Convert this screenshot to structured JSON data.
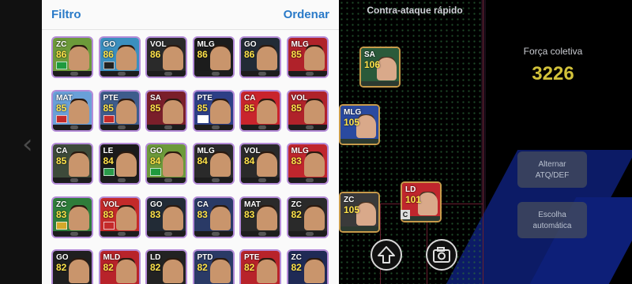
{
  "panel": {
    "filter_label": "Filtro",
    "order_label": "Ordenar",
    "cards": [
      {
        "pos": "ZC",
        "ovr": "86",
        "bg": "#6c9a3a",
        "flag": "#1f9a3e"
      },
      {
        "pos": "GO",
        "ovr": "86",
        "bg": "#3b8fbf",
        "flag": "#222222"
      },
      {
        "pos": "VOL",
        "ovr": "86",
        "bg": "#2a2a2a",
        "flag": ""
      },
      {
        "pos": "MLG",
        "ovr": "86",
        "bg": "#1c1c1c",
        "flag": ""
      },
      {
        "pos": "GO",
        "ovr": "86",
        "bg": "#222b36",
        "flag": ""
      },
      {
        "pos": "MLG",
        "ovr": "85",
        "bg": "#b0222a",
        "flag": ""
      },
      {
        "pos": "MAT",
        "ovr": "85",
        "bg": "#6aa0d8",
        "flag": "#c42a2a"
      },
      {
        "pos": "PTE",
        "ovr": "85",
        "bg": "#3e5c8c",
        "flag": "#c42a2a"
      },
      {
        "pos": "SA",
        "ovr": "85",
        "bg": "#7a1f2a",
        "flag": ""
      },
      {
        "pos": "PTE",
        "ovr": "85",
        "bg": "#2d3f86",
        "flag": "#ffffff"
      },
      {
        "pos": "CA",
        "ovr": "85",
        "bg": "#c9242c",
        "flag": ""
      },
      {
        "pos": "VOL",
        "ovr": "85",
        "bg": "#b0222a",
        "flag": ""
      },
      {
        "pos": "CA",
        "ovr": "85",
        "bg": "#3d4a3a",
        "flag": ""
      },
      {
        "pos": "LE",
        "ovr": "84",
        "bg": "#1b1b1b",
        "flag": "#2a9a4a"
      },
      {
        "pos": "GO",
        "ovr": "84",
        "bg": "#6c9a3a",
        "flag": "#1f9a3e"
      },
      {
        "pos": "MLG",
        "ovr": "84",
        "bg": "#2a2a2a",
        "flag": ""
      },
      {
        "pos": "VOL",
        "ovr": "84",
        "bg": "#2a2a2a",
        "flag": ""
      },
      {
        "pos": "MLG",
        "ovr": "83",
        "bg": "#c0262d",
        "flag": ""
      },
      {
        "pos": "ZC",
        "ovr": "83",
        "bg": "#2e7d3a",
        "flag": "#d4a82a"
      },
      {
        "pos": "VOL",
        "ovr": "83",
        "bg": "#c42a2a",
        "flag": "#c42a2a"
      },
      {
        "pos": "GO",
        "ovr": "83",
        "bg": "#222b36",
        "flag": ""
      },
      {
        "pos": "CA",
        "ovr": "83",
        "bg": "#2a3a66",
        "flag": ""
      },
      {
        "pos": "MAT",
        "ovr": "83",
        "bg": "#2a2a2a",
        "flag": ""
      },
      {
        "pos": "ZC",
        "ovr": "82",
        "bg": "#2a2a2a",
        "flag": ""
      },
      {
        "pos": "GO",
        "ovr": "82",
        "bg": "#1f1f1f",
        "flag": ""
      },
      {
        "pos": "MLD",
        "ovr": "82",
        "bg": "#b8232a",
        "flag": ""
      },
      {
        "pos": "LD",
        "ovr": "82",
        "bg": "#222222",
        "flag": ""
      },
      {
        "pos": "PTD",
        "ovr": "82",
        "bg": "#2a3a66",
        "flag": ""
      },
      {
        "pos": "PTE",
        "ovr": "82",
        "bg": "#b8232a",
        "flag": ""
      },
      {
        "pos": "ZC",
        "ovr": "82",
        "bg": "#1f2a55",
        "flag": ""
      }
    ]
  },
  "field": {
    "formation_title": "Contra-ataque rápido",
    "strength_label": "Força coletiva",
    "strength_value": "3226",
    "switch_button": "Alternar\nATQ/DEF",
    "auto_button": "Escolha\nautomática",
    "c_badge": "C",
    "players": [
      {
        "pos": "SA",
        "ovr": "106",
        "bg": "#2a5a3a"
      },
      {
        "pos": "MLG",
        "ovr": "105",
        "bg": "#2a4aa0"
      },
      {
        "pos": "ZC",
        "ovr": "105",
        "bg": "#3a3a3a"
      },
      {
        "pos": "LD",
        "ovr": "101",
        "bg": "#c0262d"
      }
    ]
  },
  "icons": {
    "up_button": "up-arrow-icon",
    "camera_button": "camera-icon",
    "back": "chevron-left-icon"
  }
}
